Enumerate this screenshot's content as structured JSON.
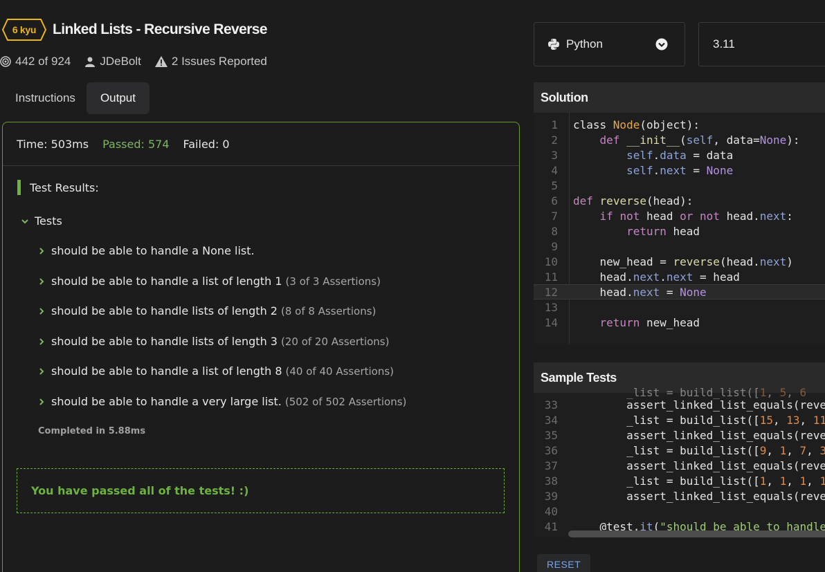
{
  "kata": {
    "rank": "6 kyu",
    "title": "Linked Lists - Recursive Reverse",
    "stats": "442 of 924",
    "author": "JDeBolt",
    "issues": "2 Issues Reported"
  },
  "tabs": [
    {
      "label": "Instructions",
      "active": false
    },
    {
      "label": "Output",
      "active": true
    }
  ],
  "output": {
    "time": "Time: 503ms",
    "passed": "Passed: 574",
    "failed": "Failed: 0",
    "results_header": "Test Results:",
    "group": "Tests",
    "tests": [
      {
        "name": "should be able to handle a None list.",
        "assertions": ""
      },
      {
        "name": "should be able to handle a list of length 1",
        "assertions": "(3 of 3 Assertions)"
      },
      {
        "name": "should be able to handle lists of length 2",
        "assertions": "(8 of 8 Assertions)"
      },
      {
        "name": "should be able to handle lists of length 3",
        "assertions": "(20 of 20 Assertions)"
      },
      {
        "name": "should be able to handle a list of length 8",
        "assertions": "(40 of 40 Assertions)"
      },
      {
        "name": "should be able to handle a very large list.",
        "assertions": "(502 of 502 Assertions)"
      }
    ],
    "completed": "Completed in 5.88ms",
    "success_message": "You have passed all of the tests! :)"
  },
  "language": {
    "selected": "Python",
    "version": "3.11"
  },
  "solution": {
    "title": "Solution",
    "line_numbers": [
      "1",
      "2",
      "3",
      "4",
      "5",
      "6",
      "7",
      "8",
      "9",
      "10",
      "11",
      "12",
      "13",
      "14"
    ]
  },
  "sample_tests": {
    "title": "Sample Tests",
    "line_numbers": [
      "33",
      "34",
      "35",
      "36",
      "37",
      "38",
      "39",
      "40",
      "41"
    ]
  },
  "reset_label": "RESET",
  "colors": {
    "accent_green": "#6cb33f",
    "rank_yellow": "#ecb613",
    "link_blue": "#7aa5e8"
  }
}
